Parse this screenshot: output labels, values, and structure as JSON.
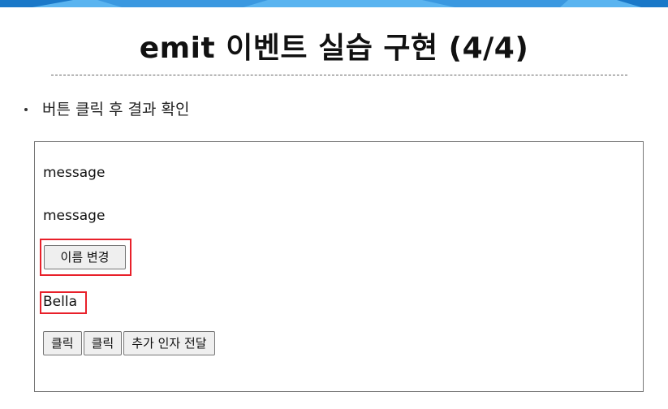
{
  "slide": {
    "title": "emit 이벤트 실습 구현 (4/4)",
    "bullet": "버튼 클릭 후 결과 확인"
  },
  "demo": {
    "messages": [
      "message",
      "message"
    ],
    "rename_button": "이름 변경",
    "name_value": "Bella",
    "buttons": [
      "클릭",
      "클릭",
      "추가 인자 전달"
    ]
  },
  "colors": {
    "highlight": "#e8202a",
    "band_light": "#5ab4f0",
    "band_dark": "#1a78c8"
  }
}
